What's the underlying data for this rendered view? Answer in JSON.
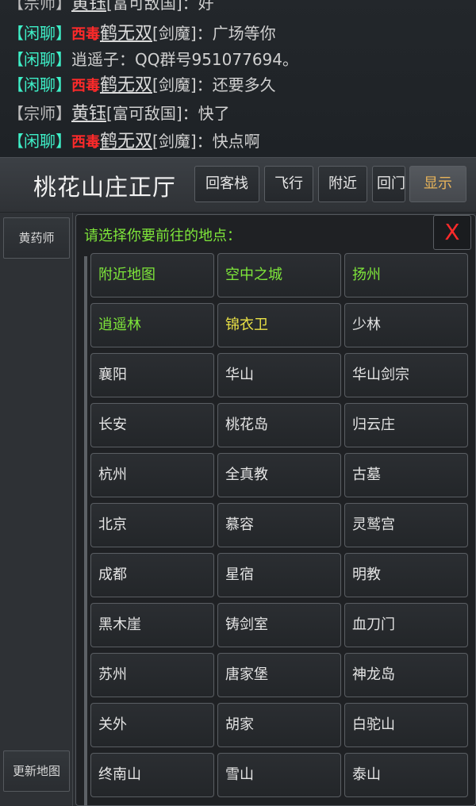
{
  "chat": {
    "lines": [
      {
        "channel": "宗师",
        "tag": "",
        "user": "黄钰",
        "faction": "[富可敌国]",
        "message": "：好"
      },
      {
        "channel": "闲聊",
        "tag": "西毒",
        "user": "鹤无双",
        "faction": "[剑魔]",
        "message": "：广场等你"
      },
      {
        "channel": "闲聊",
        "tag": "",
        "user": "",
        "faction": "",
        "message": "逍遥子：QQ群号951077694。"
      },
      {
        "channel": "闲聊",
        "tag": "西毒",
        "user": "鹤无双",
        "faction": "[剑魔]",
        "message": "：还要多久"
      },
      {
        "channel": "宗师",
        "tag": "",
        "user": "黄钰",
        "faction": "[富可敌国]",
        "message": "：快了"
      },
      {
        "channel": "闲聊",
        "tag": "西毒",
        "user": "鹤无双",
        "faction": "[剑魔]",
        "message": "：快点啊"
      }
    ]
  },
  "header": {
    "room_title": "桃花山庄正厅",
    "buttons": [
      "回客栈",
      "飞行",
      "附近",
      "回门派",
      "显示"
    ]
  },
  "left_panel": {
    "npc_button": "黄药师",
    "update_map_button": "更新地图"
  },
  "dialog": {
    "title": "请选择你要前往的地点：",
    "close_label": "X",
    "locations": [
      {
        "name": "附近地图",
        "color": "green"
      },
      {
        "name": "空中之城",
        "color": "green"
      },
      {
        "name": "扬州",
        "color": "green"
      },
      {
        "name": "逍遥林",
        "color": "green"
      },
      {
        "name": "锦衣卫",
        "color": "yellow"
      },
      {
        "name": "少林",
        "color": "white"
      },
      {
        "name": "襄阳",
        "color": "white"
      },
      {
        "name": "华山",
        "color": "white"
      },
      {
        "name": "华山剑宗",
        "color": "white"
      },
      {
        "name": "长安",
        "color": "white"
      },
      {
        "name": "桃花岛",
        "color": "white"
      },
      {
        "name": "归云庄",
        "color": "white"
      },
      {
        "name": "杭州",
        "color": "white"
      },
      {
        "name": "全真教",
        "color": "white"
      },
      {
        "name": "古墓",
        "color": "white"
      },
      {
        "name": "北京",
        "color": "white"
      },
      {
        "name": "慕容",
        "color": "white"
      },
      {
        "name": "灵鹫宫",
        "color": "white"
      },
      {
        "name": "成都",
        "color": "white"
      },
      {
        "name": "星宿",
        "color": "white"
      },
      {
        "name": "明教",
        "color": "white"
      },
      {
        "name": "黑木崖",
        "color": "white"
      },
      {
        "name": "铸剑室",
        "color": "white"
      },
      {
        "name": "血刀门",
        "color": "white"
      },
      {
        "name": "苏州",
        "color": "white"
      },
      {
        "name": "唐家堡",
        "color": "white"
      },
      {
        "name": "神龙岛",
        "color": "white"
      },
      {
        "name": "关外",
        "color": "white"
      },
      {
        "name": "胡家",
        "color": "white"
      },
      {
        "name": "白驼山",
        "color": "white"
      },
      {
        "name": "终南山",
        "color": "white"
      },
      {
        "name": "雪山",
        "color": "white"
      },
      {
        "name": "泰山",
        "color": "white"
      }
    ]
  },
  "colors": {
    "accent_green": "#7ee63a",
    "accent_yellow": "#e8e046",
    "channel_chat": "#3ef0c8",
    "tag_red": "#ff2a2a",
    "show_button": "#e8b45a"
  }
}
